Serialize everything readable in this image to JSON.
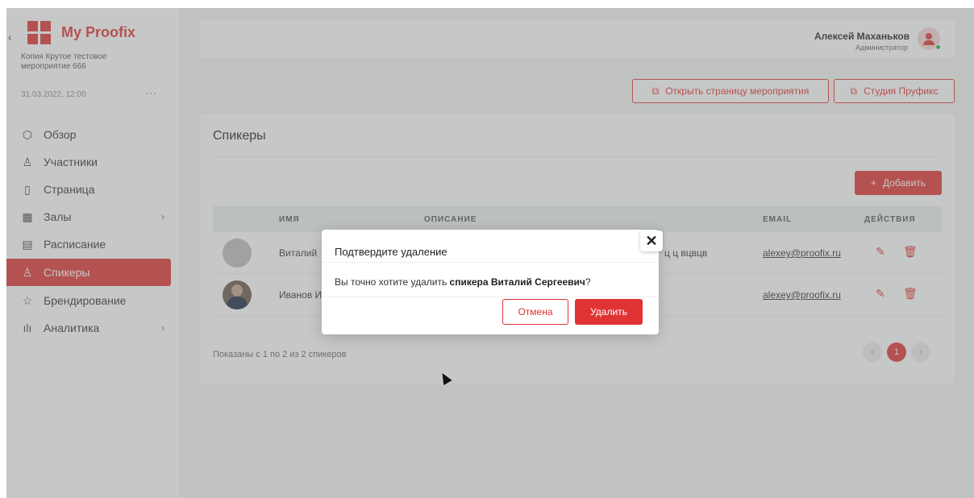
{
  "sidebar": {
    "collapse": "‹",
    "brand": "My Proofix",
    "event_name": "Копия Крутое тестовое мероприятие 666",
    "event_date": "31.03.2022, 12:00",
    "more": "···",
    "items": [
      {
        "label": "Обзор",
        "icon": "cube-icon"
      },
      {
        "label": "Участники",
        "icon": "users-icon"
      },
      {
        "label": "Страница",
        "icon": "page-icon"
      },
      {
        "label": "Залы",
        "icon": "grid-icon",
        "chevron": "›"
      },
      {
        "label": "Расписание",
        "icon": "calendar-icon"
      },
      {
        "label": "Спикеры",
        "icon": "user-icon",
        "active": true
      },
      {
        "label": "Брендирование",
        "icon": "star-icon"
      },
      {
        "label": "Аналитика",
        "icon": "bar-chart-icon",
        "chevron": "›"
      }
    ]
  },
  "header": {
    "user_name": "Алексей Маханьков",
    "user_role": "Администратор"
  },
  "actions": {
    "open_page": "Открыть страницу мероприятия",
    "studio": "Студия Пруфикс"
  },
  "speakers": {
    "title": "Спикеры",
    "add_button": "Добавить",
    "columns": [
      "ИМЯ",
      "ОПИСАНИЕ",
      "EMAIL",
      "ДЕЙСТВИЯ"
    ],
    "rows": [
      {
        "name": "Виталий",
        "description": "ц ц вцвцв",
        "email": "alexey@proofix.ru"
      },
      {
        "name": "Иванов И",
        "description": "",
        "email": "alexey@proofix.ru"
      }
    ],
    "shown": "Показаны с 1 по 2 из 2 спикеров",
    "pager": {
      "prev": "‹",
      "current": "1",
      "next": "›"
    }
  },
  "modal": {
    "title": "Подтвердите удаление",
    "body_prefix": "Вы точно хотите удалить ",
    "body_bold": "спикера Виталий Сергеевич",
    "body_suffix": "?",
    "close": "✕",
    "cancel": "Отмена",
    "delete": "Удалить"
  },
  "colors": {
    "accent": "#e03434",
    "online": "#33b34a"
  }
}
